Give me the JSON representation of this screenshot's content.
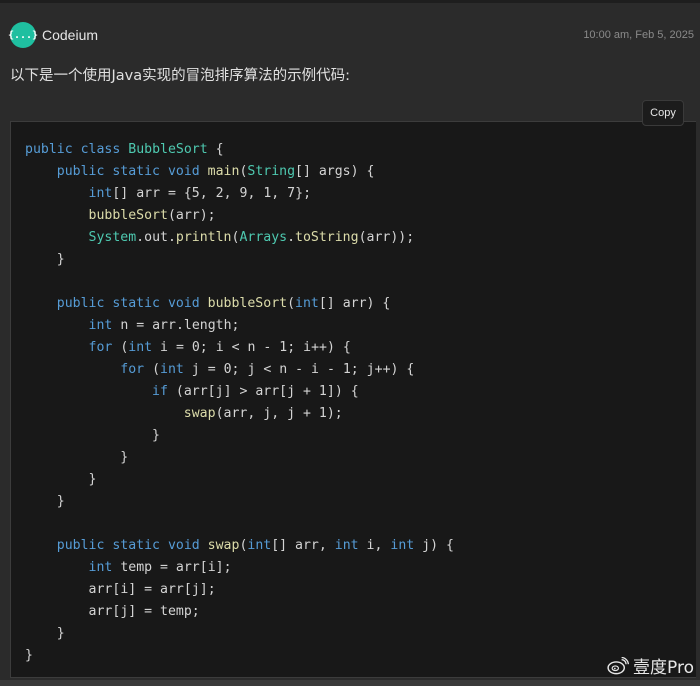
{
  "header": {
    "app_name": "Codeium",
    "logo_text": "{...}",
    "timestamp": "10:00 am, Feb 5, 2025"
  },
  "message": {
    "intro": "以下是一个使用Java实现的冒泡排序算法的示例代码:"
  },
  "code_block": {
    "copy_label": "Copy",
    "language": "java",
    "lines": [
      "public class BubbleSort {",
      "    public static void main(String[] args) {",
      "        int[] arr = {5, 2, 9, 1, 7};",
      "        bubbleSort(arr);",
      "        System.out.println(Arrays.toString(arr));",
      "    }",
      "",
      "    public static void bubbleSort(int[] arr) {",
      "        int n = arr.length;",
      "        for (int i = 0; i < n - 1; i++) {",
      "            for (int j = 0; j < n - i - 1; j++) {",
      "                if (arr[j] > arr[j + 1]) {",
      "                    swap(arr, j, j + 1);",
      "                }",
      "            }",
      "        }",
      "    }",
      "",
      "    public static void swap(int[] arr, int i, int j) {",
      "        int temp = arr[i];",
      "        arr[i] = arr[j];",
      "        arr[j] = temp;",
      "    }",
      "}"
    ]
  },
  "watermark": {
    "text": "壹度Pro",
    "icon": "weibo-icon"
  },
  "colors": {
    "keyword": "#569cd6",
    "type_name": "#4ec9b0",
    "method": "#dcdcaa",
    "plain": "#d4d4d4",
    "logo_bg": "#1fbfa0"
  }
}
